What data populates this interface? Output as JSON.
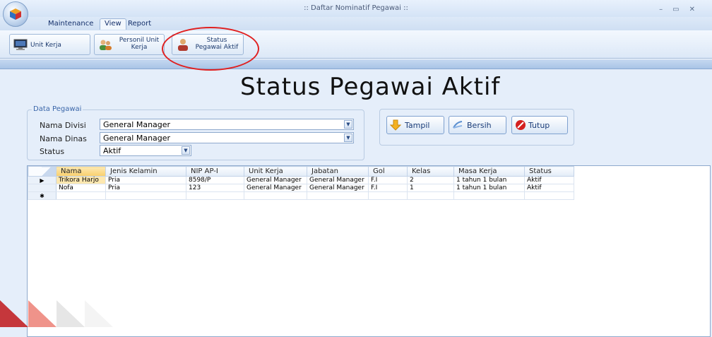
{
  "window": {
    "title": ":: Daftar Nominatif Pegawai ::",
    "controls": [
      "–",
      "▭",
      "✕"
    ]
  },
  "menu": {
    "tabs": [
      "Maintenance",
      "View",
      "Report"
    ],
    "active": "View"
  },
  "ribbon": {
    "unit_kerja": "Unit Kerja",
    "personil_line1": "Personil Unit",
    "personil_line2": "Kerja",
    "status_line1": "Status",
    "status_line2": "Pegawai Aktif"
  },
  "page": {
    "title": "Status Pegawai Aktif"
  },
  "filter": {
    "group_title": "Data Pegawai",
    "divisi_label": "Nama Divisi",
    "divisi_value": "General Manager",
    "dinas_label": "Nama Dinas",
    "dinas_value": "General Manager",
    "status_label": "Status",
    "status_value": "Aktif"
  },
  "actions": {
    "tampil": "Tampil",
    "bersih": "Bersih",
    "tutup": "Tutup"
  },
  "grid": {
    "columns": [
      "Nama",
      "Jenis Kelamin",
      "NIP AP-I",
      "Unit Kerja",
      "Jabatan",
      "Gol",
      "Kelas",
      "Masa Kerja",
      "Status"
    ],
    "rows": [
      [
        "Trikora Harjo",
        "Pria",
        "8598/P",
        "General Manager",
        "General Manager",
        "F.I",
        "2",
        "1 tahun 1 bulan",
        "Aktif"
      ],
      [
        "Nofa",
        "Pria",
        "123",
        "General Manager",
        "General Manager",
        "F.I",
        "1",
        "1 tahun 1 bulan",
        "Aktif"
      ]
    ],
    "new_row_marker": "✱",
    "current_row_marker": "▶"
  },
  "colors": {
    "accent_red": "#e02020",
    "ribbon_blue": "#dce8f7",
    "selected_cell": "#fde8b0"
  }
}
